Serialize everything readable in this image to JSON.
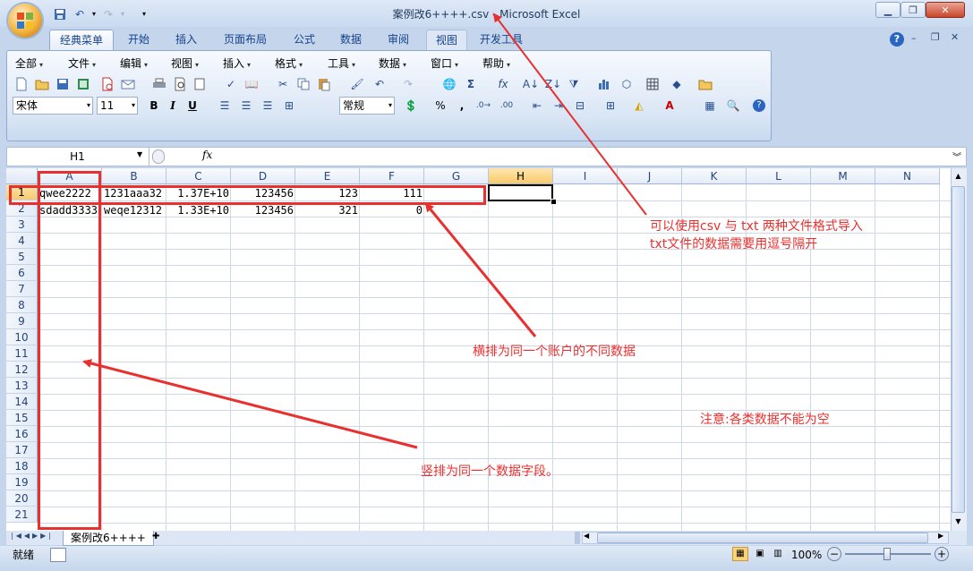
{
  "app": {
    "window_title": "案例改6++++.csv - Microsoft Excel"
  },
  "qat": {
    "save_icon": "save-icon",
    "undo_icon": "undo-icon",
    "redo_icon": "redo-icon"
  },
  "ribbon_tabs": [
    "经典菜单",
    "开始",
    "插入",
    "页面布局",
    "公式",
    "数据",
    "审阅",
    "视图",
    "开发工具"
  ],
  "classic_menu": [
    "全部",
    "文件",
    "编辑",
    "视图",
    "插入",
    "格式",
    "工具",
    "数据",
    "窗口",
    "帮助"
  ],
  "format_bar": {
    "font_name": "宋体",
    "font_size": "11",
    "bold": "B",
    "italic": "I",
    "underline": "U",
    "number_format": "常规",
    "percent": "%",
    "comma": ","
  },
  "formula_bar": {
    "name_box": "H1",
    "fx": "fx",
    "content": ""
  },
  "columns": [
    "A",
    "B",
    "C",
    "D",
    "E",
    "F",
    "G",
    "H",
    "I",
    "J",
    "K",
    "L",
    "M",
    "N"
  ],
  "selected_column": "H",
  "rows": [
    "1",
    "2",
    "3",
    "4",
    "5",
    "6",
    "7",
    "8",
    "9",
    "10",
    "11",
    "12",
    "13",
    "14",
    "15",
    "16",
    "17",
    "18",
    "19",
    "20",
    "21"
  ],
  "cells": {
    "r1": [
      "qwee2222",
      "1231aaa32",
      "1.37E+10",
      "123456",
      "123",
      "111"
    ],
    "r2": [
      "sdadd3333",
      "weqe12312",
      "1.33E+10",
      "123456",
      "321",
      "0"
    ]
  },
  "annotations": {
    "note1_line1": "可以使用csv 与 txt 两种文件格式导入",
    "note1_line2": "txt文件的数据需要用逗号隔开",
    "note2": "横排为同一个账户的不同数据",
    "note3": "注意:各类数据不能为空",
    "note4": "竖排为同一个数据字段。"
  },
  "sheet": {
    "tab_name": "案例改6++++"
  },
  "status": {
    "mode": "就绪",
    "zoom": "100%"
  },
  "colors": {
    "annotation_red": "#e8312f",
    "selected_header": "#f9c96a"
  }
}
